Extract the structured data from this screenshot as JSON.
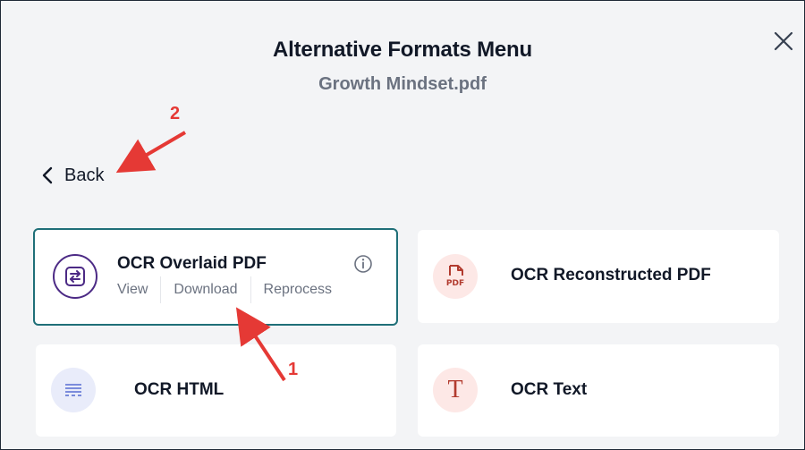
{
  "dialog": {
    "title": "Alternative Formats Menu",
    "filename": "Growth Mindset.pdf",
    "back_label": "Back"
  },
  "formats": [
    {
      "name": "OCR Overlaid PDF",
      "selected": true,
      "icon": "swap-icon",
      "actions": [
        "View",
        "Download",
        "Reprocess"
      ]
    },
    {
      "name": "OCR Reconstructed PDF",
      "icon": "pdf-file-icon",
      "icon_text": "PDF"
    },
    {
      "name": "OCR HTML",
      "icon": "text-lines-icon"
    },
    {
      "name": "OCR Text",
      "icon": "serif-t-icon",
      "icon_text": "T"
    }
  ],
  "annotations": [
    "1",
    "2"
  ],
  "colors": {
    "selected_border": "#1f6f78",
    "overlaid_icon": "#4c2a85",
    "pdf_icon": "#b23b2f",
    "html_icon": "#6b7fd7",
    "annotation": "#e53935"
  }
}
